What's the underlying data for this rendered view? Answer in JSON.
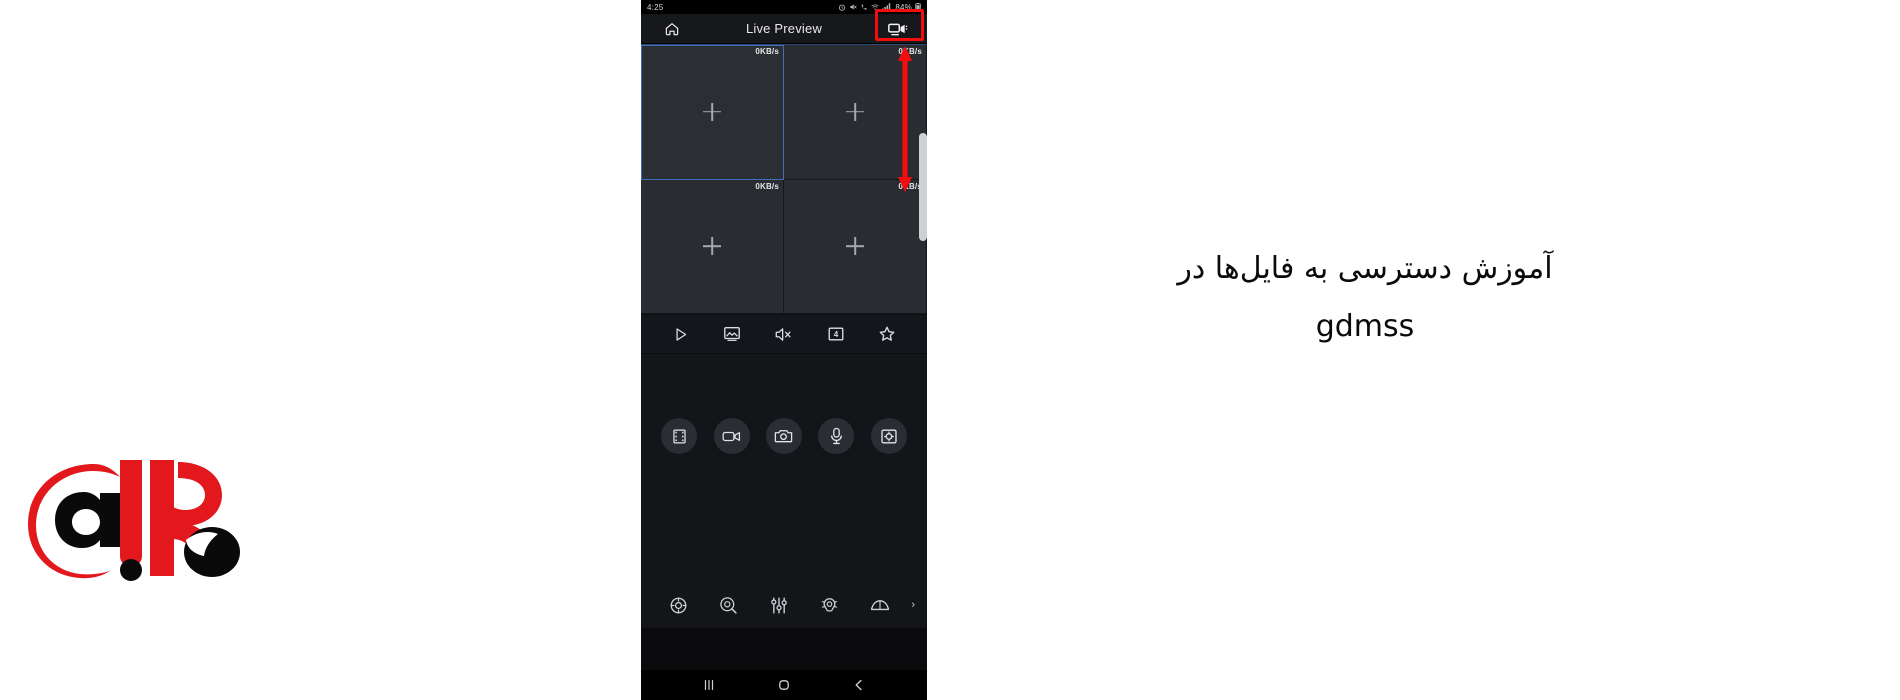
{
  "page": {
    "background": "#ffffff",
    "accent_red": "#f40d0d"
  },
  "phone": {
    "status_bar": {
      "clock": "4:25",
      "battery_percent": "84%",
      "icons": [
        "alarm-icon",
        "mute-icon",
        "call-icon",
        "wifi-icon",
        "signal-icon",
        "battery-icon"
      ]
    },
    "title_bar": {
      "home_icon": "home-icon",
      "title": "Live Preview",
      "record_icon": "camcorder-icon"
    },
    "video_grid": {
      "cells": [
        {
          "rate": "0KB/s",
          "add_label": "+",
          "selected": true
        },
        {
          "rate": "0KB/s",
          "add_label": "+",
          "selected": false
        },
        {
          "rate": "0KB/s",
          "add_label": "+",
          "selected": false
        },
        {
          "rate": "0KB/s",
          "add_label": "+",
          "selected": false
        }
      ],
      "scrollbar_color": "#cfd0d2"
    },
    "toolbar": [
      {
        "name": "play-icon",
        "label": "Play"
      },
      {
        "name": "snapshot-gallery-icon",
        "label": "Picture"
      },
      {
        "name": "mute-speaker-icon",
        "label": "Mute"
      },
      {
        "name": "split-four-icon",
        "label": "4"
      },
      {
        "name": "favorite-star-icon",
        "label": "Favorite"
      }
    ],
    "circle_buttons": [
      {
        "name": "filmstrip-icon",
        "label": "Playback"
      },
      {
        "name": "video-record-icon",
        "label": "Record"
      },
      {
        "name": "camera-snapshot-icon",
        "label": "Snapshot"
      },
      {
        "name": "microphone-icon",
        "label": "Talk"
      },
      {
        "name": "image-settings-icon",
        "label": "Image"
      }
    ],
    "feature_row": [
      {
        "name": "ptz-dial-icon",
        "label": "PTZ"
      },
      {
        "name": "zoom-focus-icon",
        "label": "Zoom"
      },
      {
        "name": "sliders-icon",
        "label": "Adjust"
      },
      {
        "name": "spotlight-icon",
        "label": "Light"
      },
      {
        "name": "wiper-icon",
        "label": "Wiper"
      }
    ],
    "feature_more": "›",
    "nav_bar": [
      {
        "name": "recent-apps-icon",
        "label": "Recents"
      },
      {
        "name": "home-circle-icon",
        "label": "Home"
      },
      {
        "name": "back-icon",
        "label": "Back"
      }
    ]
  },
  "annotation": {
    "highlight_color": "#f40d0d",
    "arrow_name": "red-pointer-arrow",
    "highlight_target": "camcorder-icon"
  },
  "caption": {
    "line1": "آموزش دسترسی به فایل‌ها در",
    "line2": "gdmss"
  },
  "logo": {
    "name": "aip-logo",
    "letter": "a",
    "colors": {
      "red": "#e2181c",
      "black": "#0a0a0a"
    }
  }
}
